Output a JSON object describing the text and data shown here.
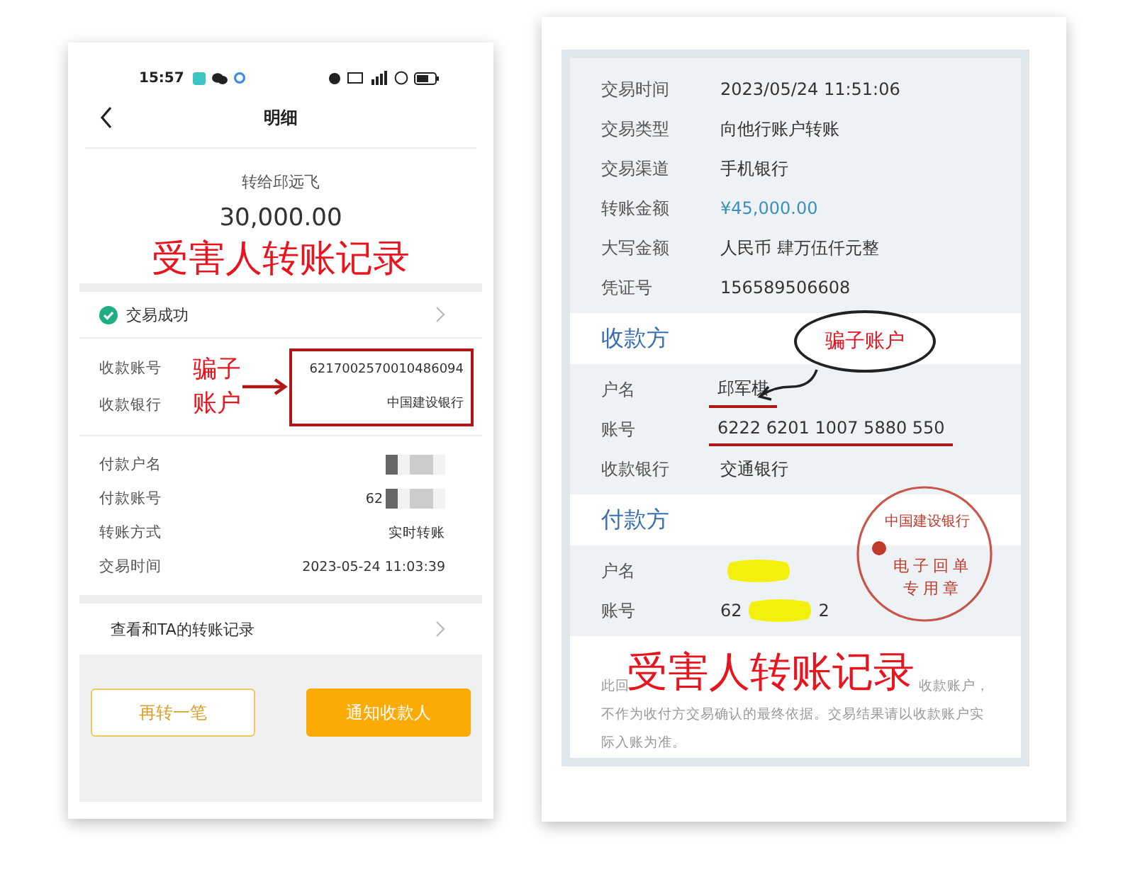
{
  "left_screen": {
    "status_bar": {
      "time": "15:57"
    },
    "header": {
      "title": "明细"
    },
    "recipient": "转给邱远飞",
    "amount": "30,000.00",
    "status": {
      "text": "交易成功"
    },
    "payee_rows": [
      {
        "label": "收款账号",
        "value": "6217002570010486094"
      },
      {
        "label": "收款银行",
        "value": "中国建设银行"
      }
    ],
    "payer_rows": [
      {
        "label": "付款户名",
        "value": "",
        "redacted": true
      },
      {
        "label": "付款账号",
        "value": "62",
        "redacted": true
      },
      {
        "label": "转账方式",
        "value": "实时转账",
        "redacted": false
      },
      {
        "label": "交易时间",
        "value": "2023-05-24 11:03:39",
        "redacted": false
      }
    ],
    "history_link": "查看和TA的转账记录",
    "buttons": [
      {
        "label": "再转一笔",
        "kind": "outline"
      },
      {
        "label": "通知收款人",
        "kind": "primary"
      }
    ]
  },
  "left_annotations": {
    "headline": "受害人转账记录",
    "callout": "骗子账户"
  },
  "right_screen": {
    "rows": [
      {
        "label": "交易时间",
        "value": "2023/05/24 11:51:06",
        "emphasis": false
      },
      {
        "label": "交易类型",
        "value": "向他行账户转账",
        "emphasis": false
      },
      {
        "label": "交易渠道",
        "value": "手机银行",
        "emphasis": false
      },
      {
        "label": "转账金额",
        "value": "¥45,000.00",
        "emphasis": true
      },
      {
        "label": "大写金额",
        "value": "人民币 肆万伍仟元整",
        "emphasis": false
      },
      {
        "label": "凭证号",
        "value": "156589506608",
        "emphasis": false
      }
    ],
    "sections": [
      {
        "title": "收款方",
        "rows": [
          {
            "label": "户名",
            "value": "邱军棋",
            "underlined": true,
            "redacted": false
          },
          {
            "label": "账号",
            "value": "6222 6201 1007 5880 550",
            "underlined": true,
            "redacted": false
          },
          {
            "label": "收款银行",
            "value": "交通银行",
            "underlined": false,
            "redacted": false
          }
        ]
      },
      {
        "title": "付款方",
        "rows": [
          {
            "label": "户名",
            "value": "",
            "underlined": false,
            "redacted": true
          },
          {
            "label": "账号",
            "value": "62",
            "value_end": "2",
            "underlined": false,
            "redacted": true
          }
        ]
      }
    ],
    "stamp": {
      "bank": "中国建设银行",
      "lines": [
        "电子回单",
        "专用章"
      ]
    },
    "footnote": [
      "此回",
      "收款账户，",
      "不作为收付方交易确认的最终依据。交易结果请以收款账户实际入账为准。"
    ]
  },
  "right_annotations": {
    "headline": "受害人转账记录",
    "callout": "骗子账户"
  }
}
